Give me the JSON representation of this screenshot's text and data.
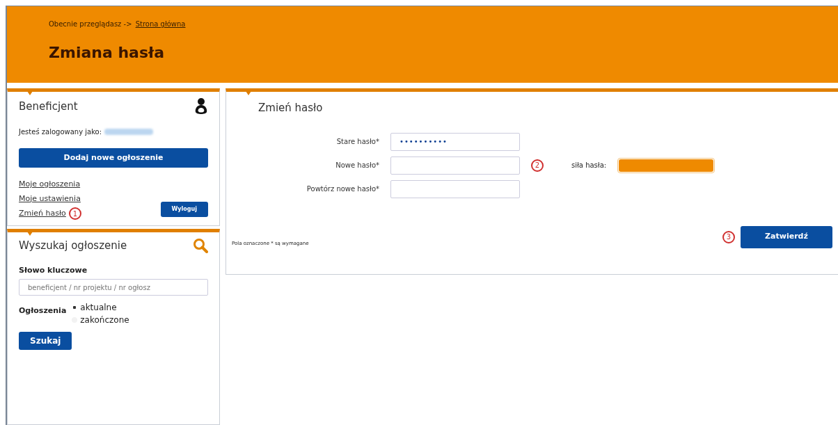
{
  "header": {
    "breadcrumb_prefix": "Obecnie przeglądasz ->",
    "breadcrumb_link": "Strona główna",
    "title": "Zmiana hasła"
  },
  "user_panel": {
    "title": "Beneficjent",
    "logged_in_label": "Jesteś zalogowany jako:",
    "add_button": "Dodaj nowe ogłoszenie",
    "links": [
      {
        "label": "Moje ogłoszenia"
      },
      {
        "label": "Moje ustawienia"
      },
      {
        "label": "Zmień hasło",
        "callout": "1"
      }
    ],
    "logout_button": "Wyloguj"
  },
  "search_panel": {
    "title": "Wyszukaj ogłoszenie",
    "keyword_label": "Słowo kluczowe",
    "placeholder": "beneficjent / nr projektu / nr ogłosz",
    "filter_label": "Ogłoszenia",
    "options": [
      {
        "label": "aktualne",
        "selected": true
      },
      {
        "label": "zakończone",
        "selected": false
      }
    ],
    "search_button": "Szukaj"
  },
  "form": {
    "title": "Zmień hasło",
    "fields": [
      {
        "label": "Stare hasło*",
        "value": "••••••••••"
      },
      {
        "label": "Nowe hasło*",
        "callout": "2"
      },
      {
        "label": "Powtórz nowe hasło*"
      }
    ],
    "strength": {
      "label": "siła hasła:",
      "level": 1
    },
    "required_note": "Pola oznaczone * są wymagane",
    "submit_callout": "3",
    "submit_button": "Zatwierdź"
  }
}
